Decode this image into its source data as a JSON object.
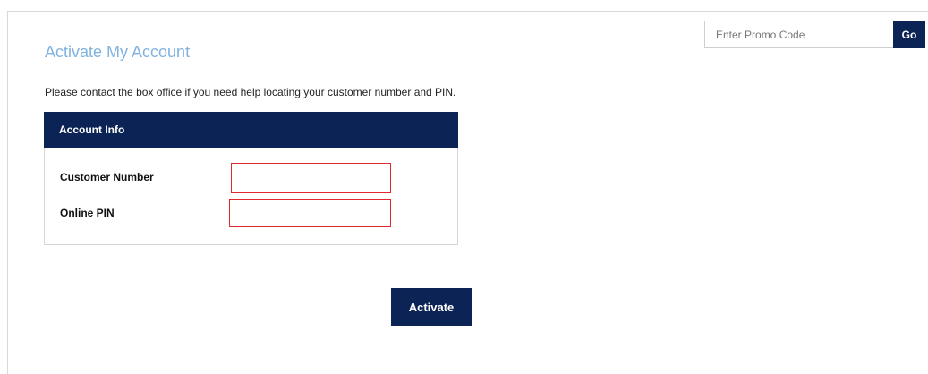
{
  "promo": {
    "placeholder": "Enter Promo Code",
    "go_label": "Go"
  },
  "page": {
    "title": "Activate My Account",
    "help_text": "Please contact the box office if you need help locating your customer number and PIN."
  },
  "account_panel": {
    "header": "Account Info",
    "fields": [
      {
        "label": "Customer Number",
        "value": ""
      },
      {
        "label": "Online PIN",
        "value": ""
      }
    ]
  },
  "actions": {
    "activate_label": "Activate"
  },
  "colors": {
    "navy": "#0b2455",
    "title_blue": "#7fb2de",
    "error_red": "#e0282e"
  }
}
